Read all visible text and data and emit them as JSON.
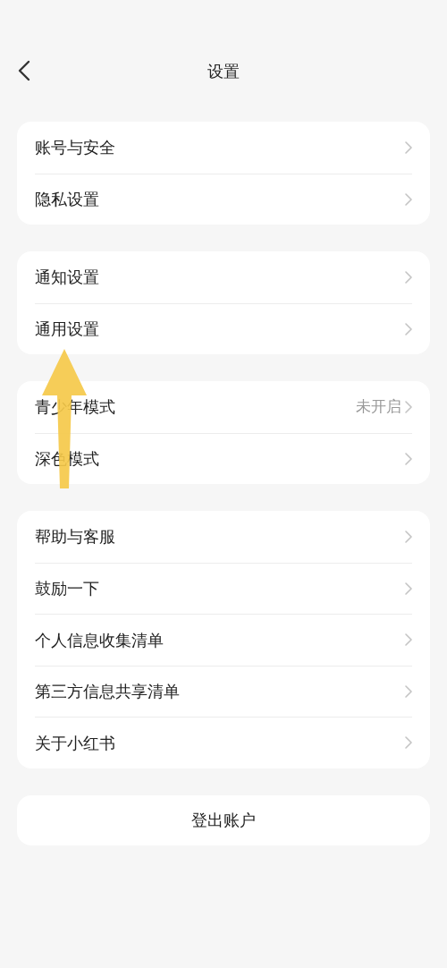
{
  "header": {
    "title": "设置"
  },
  "groups": [
    {
      "items": [
        {
          "label": "账号与安全"
        },
        {
          "label": "隐私设置"
        }
      ]
    },
    {
      "items": [
        {
          "label": "通知设置"
        },
        {
          "label": "通用设置"
        }
      ]
    },
    {
      "items": [
        {
          "label": "青少年模式",
          "value": "未开启"
        },
        {
          "label": "深色模式"
        }
      ]
    },
    {
      "items": [
        {
          "label": "帮助与客服"
        },
        {
          "label": "鼓励一下"
        },
        {
          "label": "个人信息收集清单"
        },
        {
          "label": "第三方信息共享清单"
        },
        {
          "label": "关于小红书"
        }
      ]
    }
  ],
  "logout": {
    "label": "登出账户"
  }
}
